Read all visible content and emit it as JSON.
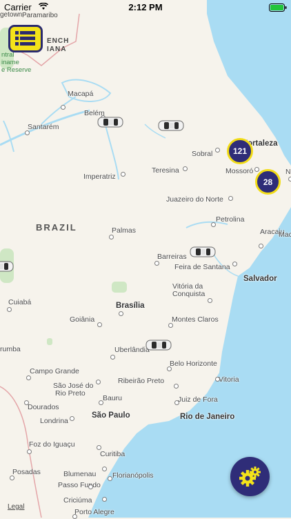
{
  "status_bar": {
    "carrier": "Carrier",
    "time": "2:12 PM"
  },
  "map": {
    "country_label": "BRAZIL",
    "top_left_labels": {
      "paramaribo": "Paramaribo",
      "getown": "getown",
      "french": "ENCH",
      "guiana": "IANA",
      "park_line1": "ntral",
      "park_line2": "iname",
      "park_line3": "e Reserve"
    },
    "cities": [
      {
        "name": "Macapá",
        "big": false
      },
      {
        "name": "Belém",
        "big": false
      },
      {
        "name": "Santarém",
        "big": false
      },
      {
        "name": "Sobral",
        "big": false
      },
      {
        "name": "Fortaleza",
        "big": true
      },
      {
        "name": "Imperatriz",
        "big": false
      },
      {
        "name": "Teresina",
        "big": false
      },
      {
        "name": "Mossoró",
        "big": false
      },
      {
        "name": "Juazeiro do Norte",
        "big": false
      },
      {
        "name": "Petrolina",
        "big": false
      },
      {
        "name": "Palmas",
        "big": false
      },
      {
        "name": "Barreiras",
        "big": false
      },
      {
        "name": "Feira de Santana",
        "big": false
      },
      {
        "name": "Aracaju",
        "big": false
      },
      {
        "name": "Salvador",
        "big": true
      },
      {
        "name": "Vitória da",
        "big": false
      },
      {
        "name": "Conquista",
        "big": false
      },
      {
        "name": "Cuiabá",
        "big": false
      },
      {
        "name": "Brasília",
        "big": true
      },
      {
        "name": "Goiânia",
        "big": false
      },
      {
        "name": "Montes Claros",
        "big": false
      },
      {
        "name": "rumba",
        "big": false
      },
      {
        "name": "Uberlândia",
        "big": false
      },
      {
        "name": "Belo Horizonte",
        "big": false
      },
      {
        "name": "Campo Grande",
        "big": false
      },
      {
        "name": "Vitoria",
        "big": false
      },
      {
        "name": "São José do",
        "big": false
      },
      {
        "name": "Rio Preto",
        "big": false
      },
      {
        "name": "Ribeirão Preto",
        "big": false
      },
      {
        "name": "Bauru",
        "big": false
      },
      {
        "name": "Juiz de Fora",
        "big": false
      },
      {
        "name": "Dourados",
        "big": false
      },
      {
        "name": "São Paulo",
        "big": true
      },
      {
        "name": "Rio de Janeiro",
        "big": true
      },
      {
        "name": "Londrina",
        "big": false
      },
      {
        "name": "Foz do Iguaçu",
        "big": false
      },
      {
        "name": "Curitiba",
        "big": false
      },
      {
        "name": "Posadas",
        "big": false
      },
      {
        "name": "Blumenau",
        "big": false
      },
      {
        "name": "Florianópolis",
        "big": false
      },
      {
        "name": "Passo Fundo",
        "big": false
      },
      {
        "name": "Criciúma",
        "big": false
      },
      {
        "name": "Porto Alegre",
        "big": false
      },
      {
        "name": "Mac",
        "big": false
      },
      {
        "name": "N",
        "big": false
      }
    ],
    "clusters": [
      {
        "count": "121"
      },
      {
        "count": "28"
      }
    ],
    "legal": "Legal"
  },
  "colors": {
    "water": "#a9dcf3",
    "land": "#f6f3ec",
    "accent_yellow": "#f4e31a",
    "accent_navy": "#2f2d78"
  },
  "icons": {
    "menu": "list-menu-icon",
    "settings": "gears-icon",
    "car": "car-icon"
  }
}
